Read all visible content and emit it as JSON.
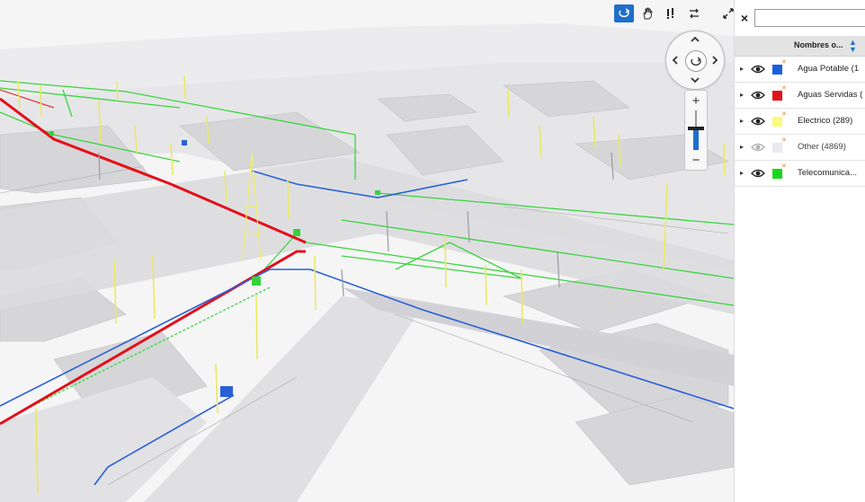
{
  "toolbar": {
    "orbit_icon": "orbit-icon",
    "pan_icon": "hand-pan-icon",
    "walk_icon": "walk-icon",
    "swap_icon": "swap-arrows-icon",
    "fullscreen_icon": "expand-icon"
  },
  "navigation": {
    "up": "^",
    "down": "v",
    "left": "<",
    "right": ">"
  },
  "zoom": {
    "plus": "+",
    "minus": "−",
    "level": 0.55
  },
  "panel": {
    "close_label": "×",
    "search_value": "",
    "column_header": "Nombres o...",
    "layers": [
      {
        "label": "Agua Potable (1",
        "color": "#1b5ee0",
        "visible": true
      },
      {
        "label": "Aguas Servidas (",
        "color": "#e3101a",
        "visible": true
      },
      {
        "label": "Electrico (289)",
        "color": "#fafb7a",
        "visible": true
      },
      {
        "label": "Other (4869)",
        "color": "#e9e9ee",
        "visible": false
      },
      {
        "label": "Telecomunica...",
        "color": "#17d81a",
        "visible": true
      }
    ]
  },
  "colors": {
    "accent": "#1e6fc9",
    "agua_potable": "#2a5fd6",
    "aguas_servidas": "#e3101a",
    "electrico": "#f2f27a",
    "telecom": "#33d43a"
  }
}
